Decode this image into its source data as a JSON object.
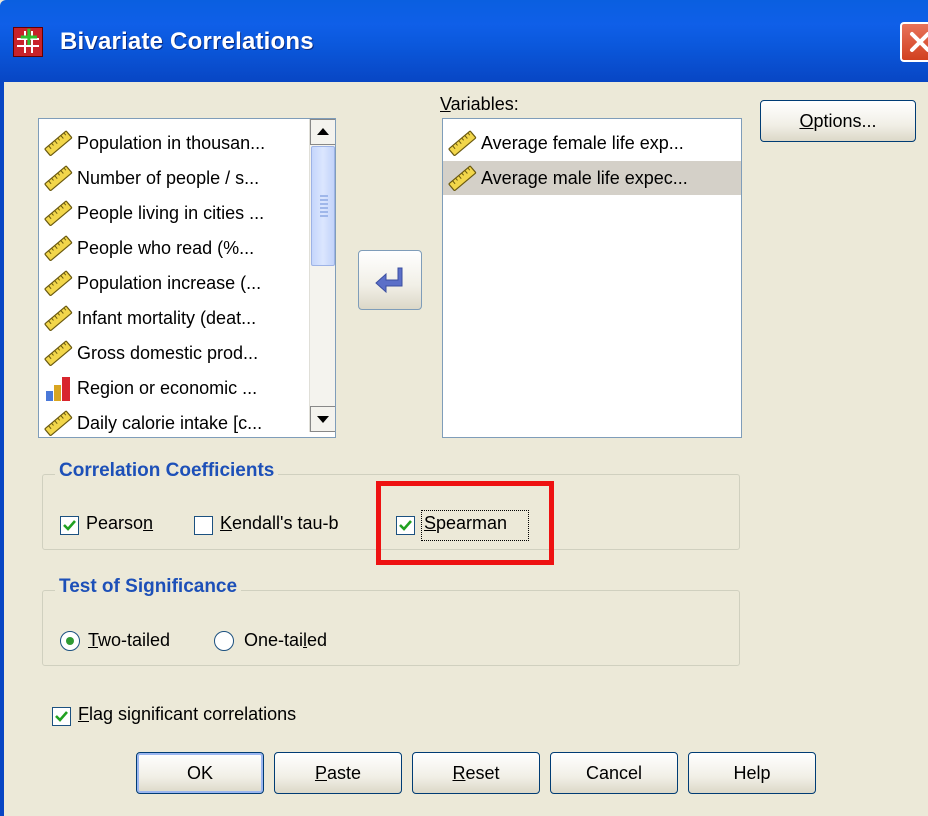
{
  "window": {
    "title": "Bivariate Correlations"
  },
  "source_list": {
    "items": [
      {
        "label": "Population in thousan...",
        "icon": "scale-icon"
      },
      {
        "label": "Number of people / s...",
        "icon": "scale-icon"
      },
      {
        "label": "People living in cities ...",
        "icon": "scale-icon"
      },
      {
        "label": "People who read (%...",
        "icon": "scale-icon"
      },
      {
        "label": "Population increase (...",
        "icon": "scale-icon"
      },
      {
        "label": "Infant mortality (deat...",
        "icon": "scale-icon"
      },
      {
        "label": "Gross domestic prod...",
        "icon": "scale-icon"
      },
      {
        "label": "Region or economic ...",
        "icon": "nominal-icon"
      },
      {
        "label": "Daily calorie intake [c...",
        "icon": "scale-icon"
      }
    ]
  },
  "variables": {
    "label_pre": "",
    "label_u": "V",
    "label_post": "ariables:",
    "items": [
      {
        "label": "Average female life exp...",
        "icon": "scale-icon"
      },
      {
        "label": "Average male life expec...",
        "icon": "scale-icon",
        "selected": true
      }
    ]
  },
  "buttons": {
    "options": {
      "u": "O",
      "rest": "ptions..."
    },
    "ok": "OK",
    "paste": {
      "u": "P",
      "rest": "aste"
    },
    "reset": {
      "u": "R",
      "rest": "eset"
    },
    "cancel": "Cancel",
    "help": "Help"
  },
  "correlation": {
    "title": "Correlation Coefficients",
    "pearson": {
      "pre": "Pearso",
      "u": "n",
      "post": "",
      "checked": true
    },
    "kendall": {
      "pre": "",
      "u": "K",
      "post": "endall's tau-b",
      "checked": false
    },
    "spearman": {
      "pre": "",
      "u": "S",
      "post": "pearman",
      "checked": true
    }
  },
  "significance": {
    "title": "Test of Significance",
    "two_tailed": {
      "u": "T",
      "post": "wo-tailed",
      "selected": true
    },
    "one_tailed": {
      "pre": "One-tai",
      "u": "l",
      "post": "ed",
      "selected": false
    }
  },
  "flag": {
    "u": "F",
    "post": "lag significant correlations",
    "checked": true
  },
  "colors": {
    "title_bar": "#0846c4",
    "group_title": "#1d50b8",
    "highlight": "#ee1111",
    "radio_dot": "#2f9a33"
  }
}
